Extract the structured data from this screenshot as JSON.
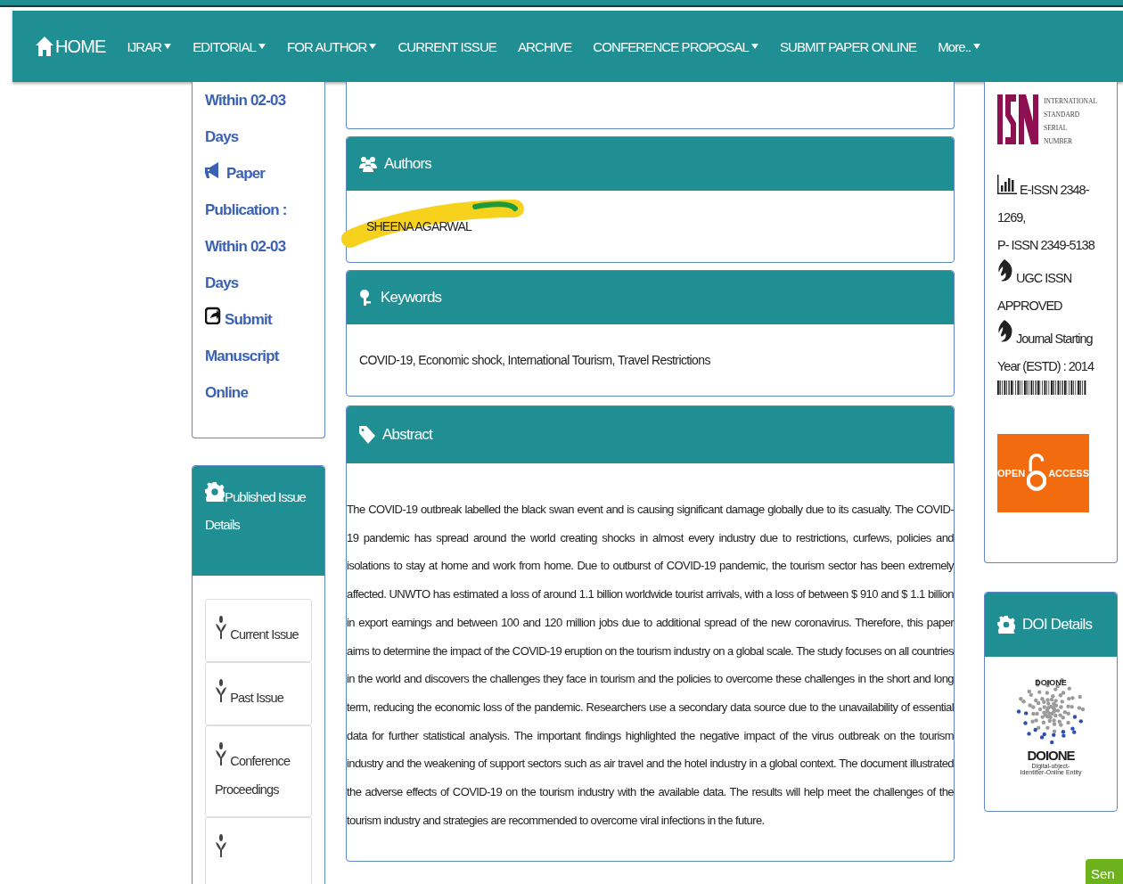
{
  "navbar": {
    "home": "HOME",
    "items": [
      {
        "label": "IJRAR",
        "dropdown": true
      },
      {
        "label": "EDITORIAL",
        "dropdown": true
      },
      {
        "label": "FOR AUTHOR",
        "dropdown": true
      },
      {
        "label": "CURRENT ISSUE",
        "dropdown": false
      },
      {
        "label": "ARCHIVE",
        "dropdown": false
      },
      {
        "label": "CONFERENCE PROPOSAL",
        "dropdown": true
      },
      {
        "label": "SUBMIT PAPER ONLINE",
        "dropdown": false
      },
      {
        "label": "More..",
        "dropdown": true
      }
    ]
  },
  "left_info": {
    "items": [
      {
        "kind": "plain",
        "text": "Within 02-03 Days"
      },
      {
        "kind": "megaphone",
        "text": "Paper Publication : Within 02-03 Days"
      },
      {
        "kind": "share",
        "text": "Submit Manuscript Online"
      }
    ]
  },
  "published_issue": {
    "title": "Published Issue Details",
    "items": [
      {
        "label": "Current Issue"
      },
      {
        "label": "Past Issue"
      },
      {
        "label": "Conference Proceedings"
      }
    ]
  },
  "authors": {
    "title": "Authors",
    "names": [
      "SHEENA AGARWAL"
    ],
    "highlighted": true
  },
  "keywords": {
    "title": "Keywords",
    "text": "COVID-19, Economic shock, International Tourism, Travel Restrictions"
  },
  "abstract": {
    "title": "Abstract",
    "text": "The COVID-19 outbreak labelled the black swan event and is causing significant damage globally due to its casualty. The COVID-19 pandemic has spread around the world creating shocks in almost every industry due to restrictions, curfews, policies and isolations to stay at home and work from home. Due to outburst of COVID-19 pandemic, the tourism sector has been extremely affected. UNWTO has estimated a loss of around 1.1 billion worldwide tourist arrivals, with a loss of between $ 910 and $ 1.1 billion in export earnings and between 100 and 120 million jobs due to additional spread of the new coronavirus. Therefore, this paper aims to determine the impact of the COVID-19 eruption on the tourism industry on a global scale. The study focuses on all countries in the world and discovers the challenges they face in tourism and the policies to overcome these challenges in the short and long term, reducing the economic loss of the pandemic. Researchers use a secondary data source due to the unavailability of essential data for further statistical analysis. The important findings highlighted the negative impact of the virus outbreak on the tourism industry and the weakening of support sectors such as air travel and the hotel industry in a global context. The document illustrated the adverse effects of COVID-19 on the tourism industry with the available data. The results will help meet the challenges of the tourism industry and strategies are recommended to overcome viral infections in the future."
  },
  "issn_panel": {
    "logo_caption": [
      "INTERNATIONAL",
      "STANDARD",
      "SERIAL",
      "NUMBER"
    ],
    "items": [
      {
        "kind": "chart",
        "lines": [
          "E-ISSN 2348-1269,",
          "P- ISSN 2349-5138"
        ]
      },
      {
        "kind": "flame",
        "lines": [
          "UGC ISSN APPROVED"
        ]
      },
      {
        "kind": "flame",
        "lines": [
          "Journal Starting Year (ESTD) : 2014"
        ]
      }
    ],
    "open_access": [
      "OPEN",
      "ACCESS"
    ]
  },
  "doi_panel": {
    "title": "DOI Details",
    "logo_top": "DOIONE",
    "logo_name": "DOIONE",
    "logo_tagline": "Digital-object-Identifier-Online Entity"
  },
  "send_button": "Sen"
}
